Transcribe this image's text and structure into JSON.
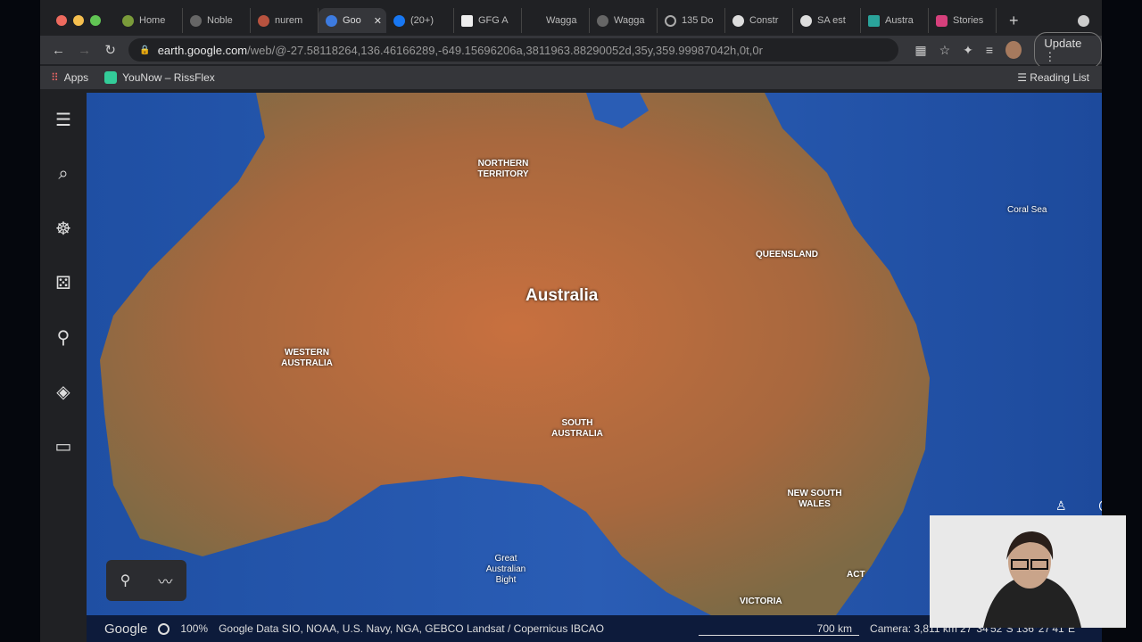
{
  "tabs": [
    {
      "label": "Home"
    },
    {
      "label": "Noble"
    },
    {
      "label": "nurem"
    },
    {
      "label": "Goo",
      "active": true
    },
    {
      "label": "(20+)"
    },
    {
      "label": "GFG A"
    },
    {
      "label": "Wagga"
    },
    {
      "label": "Wagga"
    },
    {
      "label": "135 Do"
    },
    {
      "label": "Constr"
    },
    {
      "label": "SA est"
    },
    {
      "label": "Austra"
    },
    {
      "label": "Stories"
    }
  ],
  "address": {
    "host": "earth.google.com",
    "path": "/web/@-27.58118264,136.46166289,-649.15696206a,3811963.88290052d,35y,359.99987042h,0t,0r",
    "update": "Update"
  },
  "bookmarks": {
    "apps": "Apps",
    "item1": "YouNow – RissFlex",
    "reading_list": "Reading List"
  },
  "map": {
    "country": "Australia",
    "regions": [
      "NORTHERN TERRITORY",
      "QUEENSLAND",
      "WESTERN AUSTRALIA",
      "SOUTH AUSTRALIA",
      "NEW SOUTH WALES",
      "VICTORIA",
      "ACT"
    ],
    "sea": "Coral Sea",
    "bight": "Great Australian Bight"
  },
  "status": {
    "logo": "Google",
    "loaded": "100%",
    "attribution": "Google  Data SIO, NOAA, U.S. Navy, NGA, GEBCO  Landsat / Copernicus  IBCAO",
    "scale": "700 km",
    "camera": "Camera: 3,811 km   27°34'52\"S 136°27'41\"E"
  }
}
